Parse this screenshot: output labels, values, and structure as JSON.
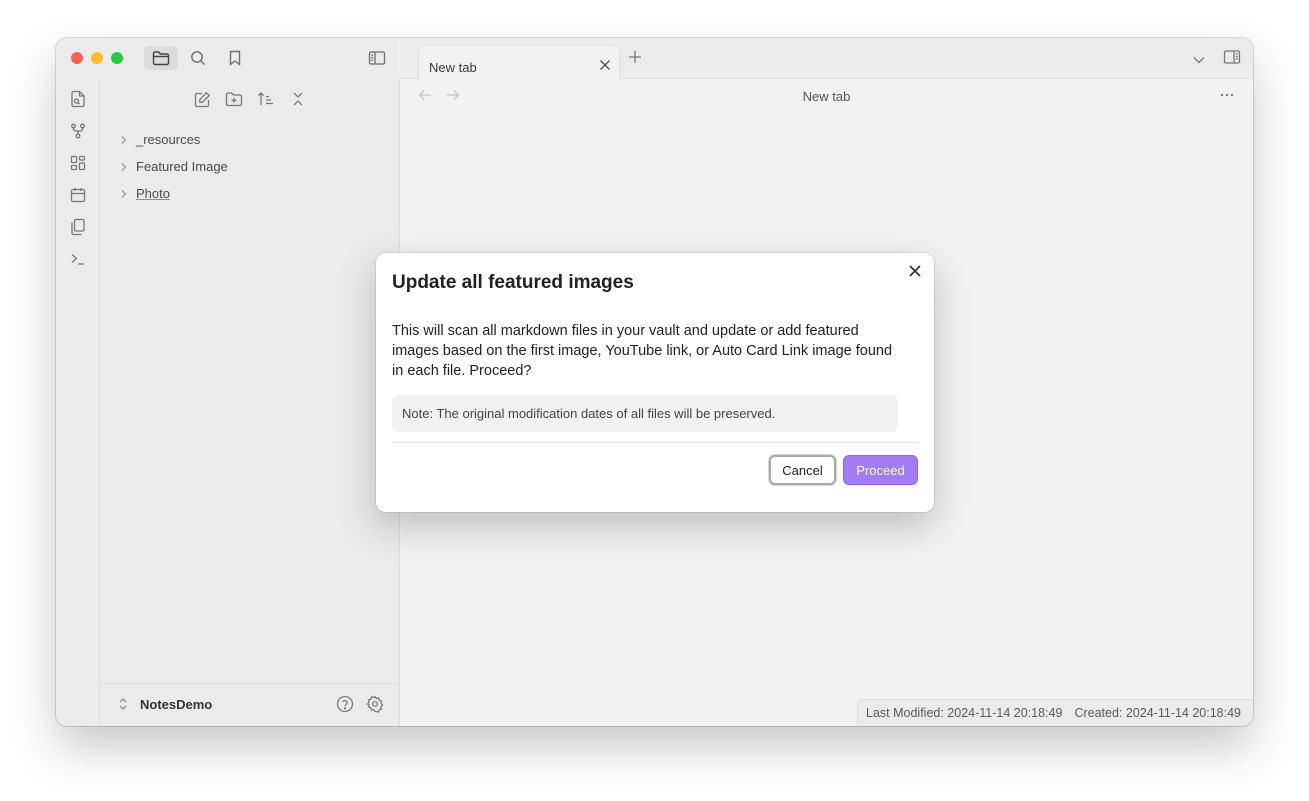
{
  "sidebar": {
    "tree": [
      {
        "label": "_resources",
        "underline": false
      },
      {
        "label": "Featured Image",
        "underline": false
      },
      {
        "label": "Photo",
        "underline": true
      }
    ],
    "vault_name": "NotesDemo"
  },
  "tabs": [
    {
      "title": "New tab",
      "active": true
    }
  ],
  "view": {
    "title": "New tab"
  },
  "status": {
    "last_modified": "Last Modified: 2024-11-14 20:18:49",
    "created": "Created: 2024-11-14 20:18:49"
  },
  "modal": {
    "title": "Update all featured images",
    "body": "This will scan all markdown files in your vault and update or add featured images based on the first image, YouTube link, or Auto Card Link image found in each file. Proceed?",
    "note": "Note: The original modification dates of all files will be preserved.",
    "cancel_label": "Cancel",
    "proceed_label": "Proceed"
  },
  "colors": {
    "accent": "#a17cf5",
    "traffic_red": "#fe5f57",
    "traffic_yellow": "#febc2e",
    "traffic_green": "#28c840"
  }
}
